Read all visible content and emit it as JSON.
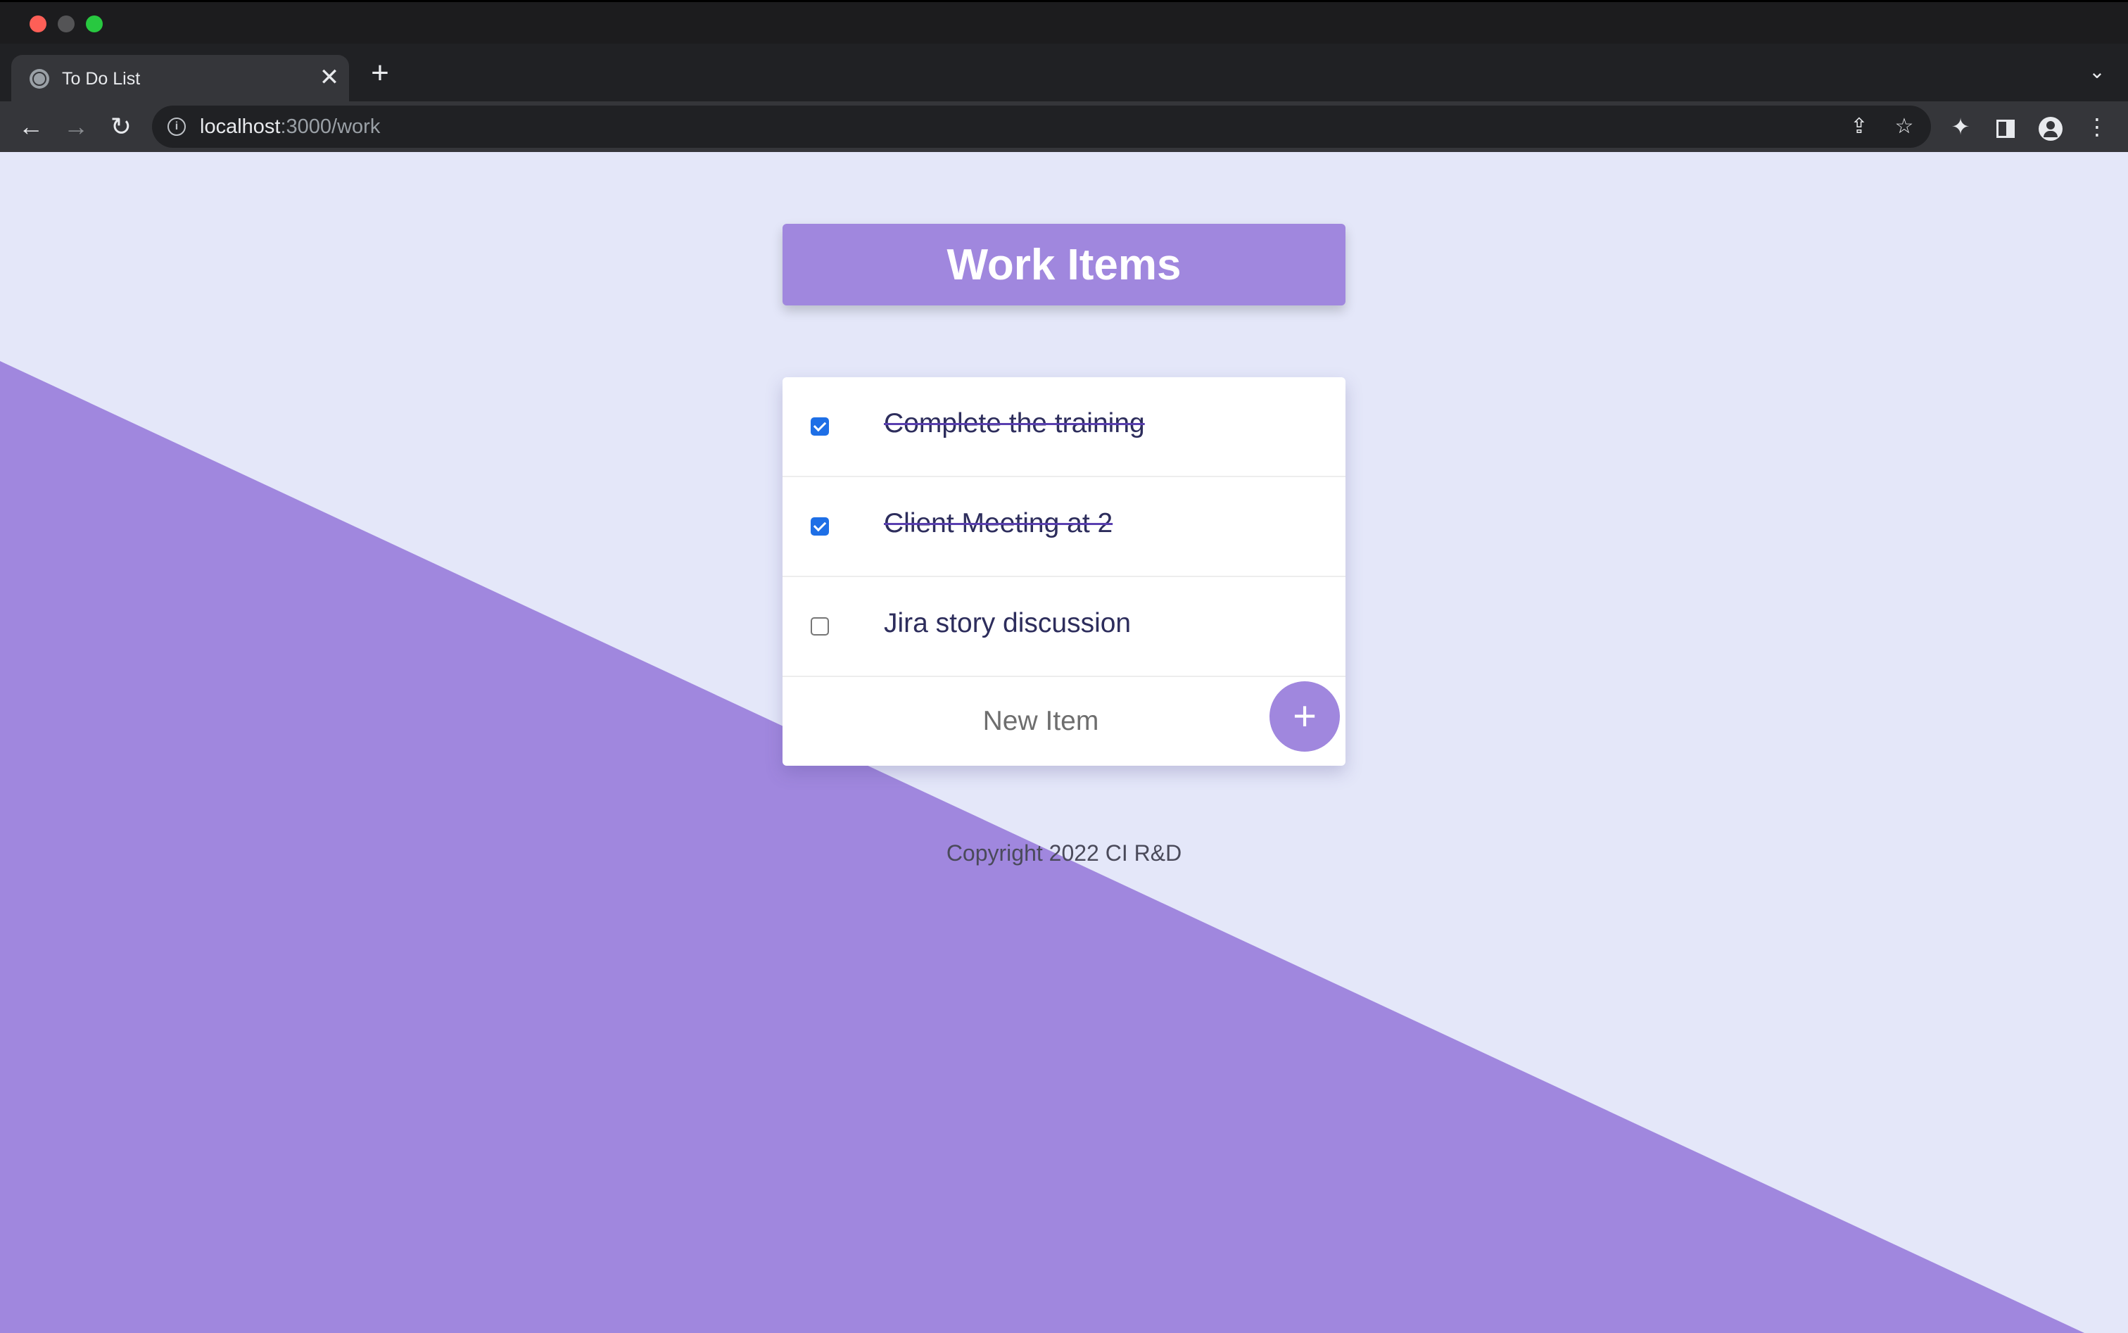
{
  "browser": {
    "tab_title": "To Do List",
    "tab_close": "✕",
    "new_tab": "+",
    "tab_menu": "⌄",
    "url_host": "localhost",
    "url_path": ":3000/work",
    "icons": {
      "back": "←",
      "forward": "→",
      "reload": "↻",
      "info": "i",
      "share": "⇪",
      "star": "☆",
      "extensions": "✦",
      "menu": "⋮"
    }
  },
  "page": {
    "heading": "Work Items",
    "items": [
      {
        "text": "Complete the training",
        "checked": true
      },
      {
        "text": "Client Meeting at 2",
        "checked": true
      },
      {
        "text": "Jira story discussion",
        "checked": false
      }
    ],
    "new_item_placeholder": "New Item",
    "add_button": "+",
    "footer": "Copyright 2022 CI R&D"
  },
  "colors": {
    "accent": "#A087DE",
    "background": "#E4E7F9",
    "checkbox": "#1E6FE6"
  }
}
